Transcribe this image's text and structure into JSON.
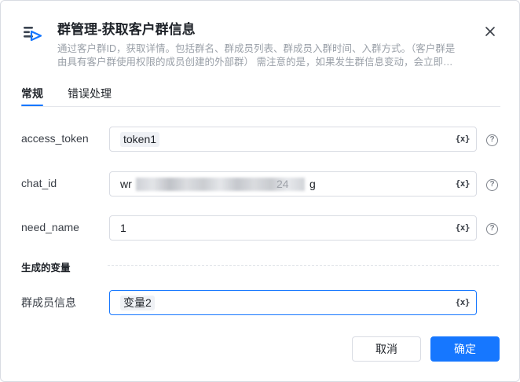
{
  "dialog": {
    "title": "群管理-获取客户群信息",
    "description_line1": "通过客户群ID，获取详情。包括群名、群成员列表、群成员入群时间、入群方式。（客户群是",
    "description_line2": "由具有客户群使用权限的成员创建的外部群）  需注意的是，如果发生群信息变动，会立即…",
    "icon": "workflow-app-icon",
    "close_icon": "close-icon"
  },
  "tabs": [
    {
      "label": "常规",
      "active": true
    },
    {
      "label": "错误处理",
      "active": false
    }
  ],
  "fields": {
    "access_token": {
      "label": "access_token",
      "value": "token1"
    },
    "chat_id": {
      "label": "chat_id",
      "value_prefix": "wr",
      "value_mid": "24",
      "value_suffix": "g"
    },
    "need_name": {
      "label": "need_name",
      "value": "1"
    },
    "var_button": "{x}",
    "help": "?"
  },
  "output": {
    "section_title": "生成的变量",
    "label": "群成员信息",
    "value": "变量2"
  },
  "buttons": {
    "cancel": "取消",
    "ok": "确定"
  },
  "colors": {
    "accent": "#1677ff",
    "border": "#d9dce3",
    "muted_text": "#9aa0a8"
  }
}
